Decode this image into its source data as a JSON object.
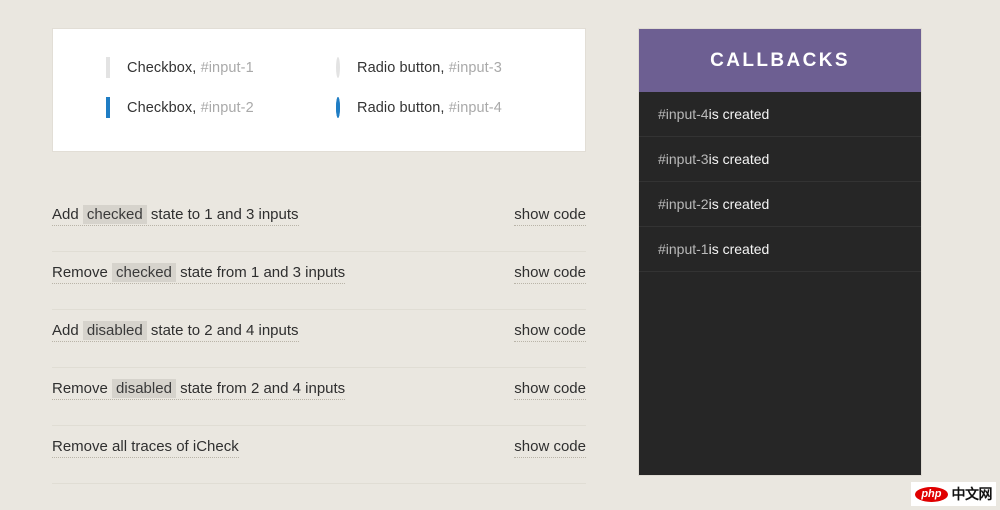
{
  "demo": {
    "rows": [
      [
        {
          "type": "checkbox",
          "checked": false,
          "label": "Checkbox,",
          "id": "#input-1"
        },
        {
          "type": "radio",
          "checked": false,
          "label": "Radio button,",
          "id": "#input-3"
        }
      ],
      [
        {
          "type": "checkbox",
          "checked": true,
          "label": "Checkbox,",
          "id": "#input-2"
        },
        {
          "type": "radio",
          "checked": true,
          "label": "Radio button,",
          "id": "#input-4"
        }
      ]
    ]
  },
  "actions": {
    "show_code_label": "show code",
    "rows": [
      {
        "pre": "Add ",
        "code": "checked",
        "post": " state to 1 and 3 inputs"
      },
      {
        "pre": "Remove ",
        "code": "checked",
        "post": " state from 1 and 3 inputs"
      },
      {
        "pre": "Add ",
        "code": "disabled",
        "post": " state to 2 and 4 inputs"
      },
      {
        "pre": "Remove ",
        "code": "disabled",
        "post": " state from 2 and 4 inputs"
      },
      {
        "pre": "Remove all traces of iCheck",
        "code": "",
        "post": ""
      }
    ]
  },
  "callbacks": {
    "title": "CALLBACKS",
    "items": [
      {
        "id": "#input-4",
        "message": " is created"
      },
      {
        "id": "#input-3",
        "message": " is created"
      },
      {
        "id": "#input-2",
        "message": " is created"
      },
      {
        "id": "#input-1",
        "message": " is created"
      }
    ]
  },
  "watermark": {
    "badge": "php",
    "text": "中文网"
  },
  "colors": {
    "page_background": "#eae7e0",
    "card_background": "#ffffff",
    "accent_blue": "#1f7dc4",
    "callbacks_header": "#6d5f92",
    "callbacks_background": "#262626",
    "watermark_red": "#e00000"
  }
}
